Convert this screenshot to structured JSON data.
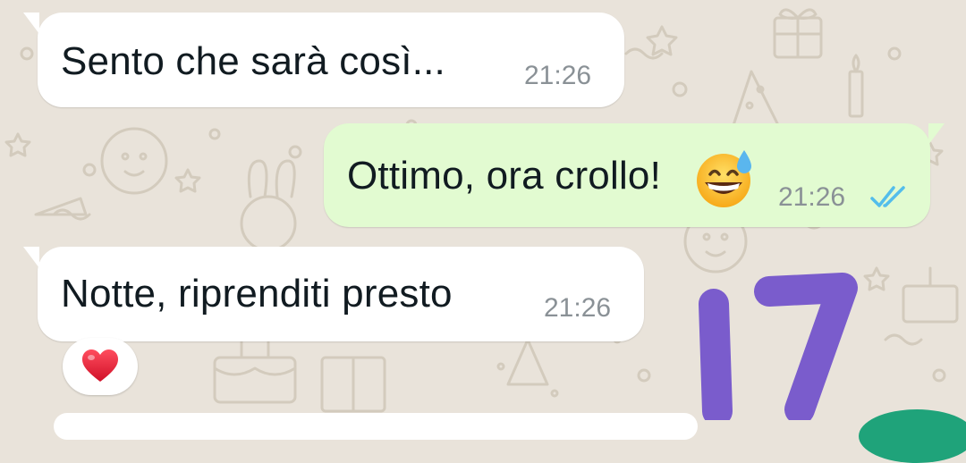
{
  "chat": {
    "messages": [
      {
        "direction": "incoming",
        "text": "Sento che sarà così...",
        "time": "21:26"
      },
      {
        "direction": "outgoing",
        "text": "Ottimo, ora crollo!",
        "emoji": "grinning-face-with-sweat",
        "time": "21:26",
        "status": "read"
      },
      {
        "direction": "incoming",
        "text": "Notte, riprenditi presto",
        "time": "21:26",
        "reaction": "red-heart"
      }
    ]
  },
  "overlay": {
    "handwritten_number": "17",
    "color": "#7a5ccc"
  },
  "colors": {
    "wallpaper": "#e9e3da",
    "incoming_bubble": "#ffffff",
    "outgoing_bubble": "#e2fbd1",
    "read_ticks": "#53bdeb",
    "fab": "#1fa37a"
  }
}
